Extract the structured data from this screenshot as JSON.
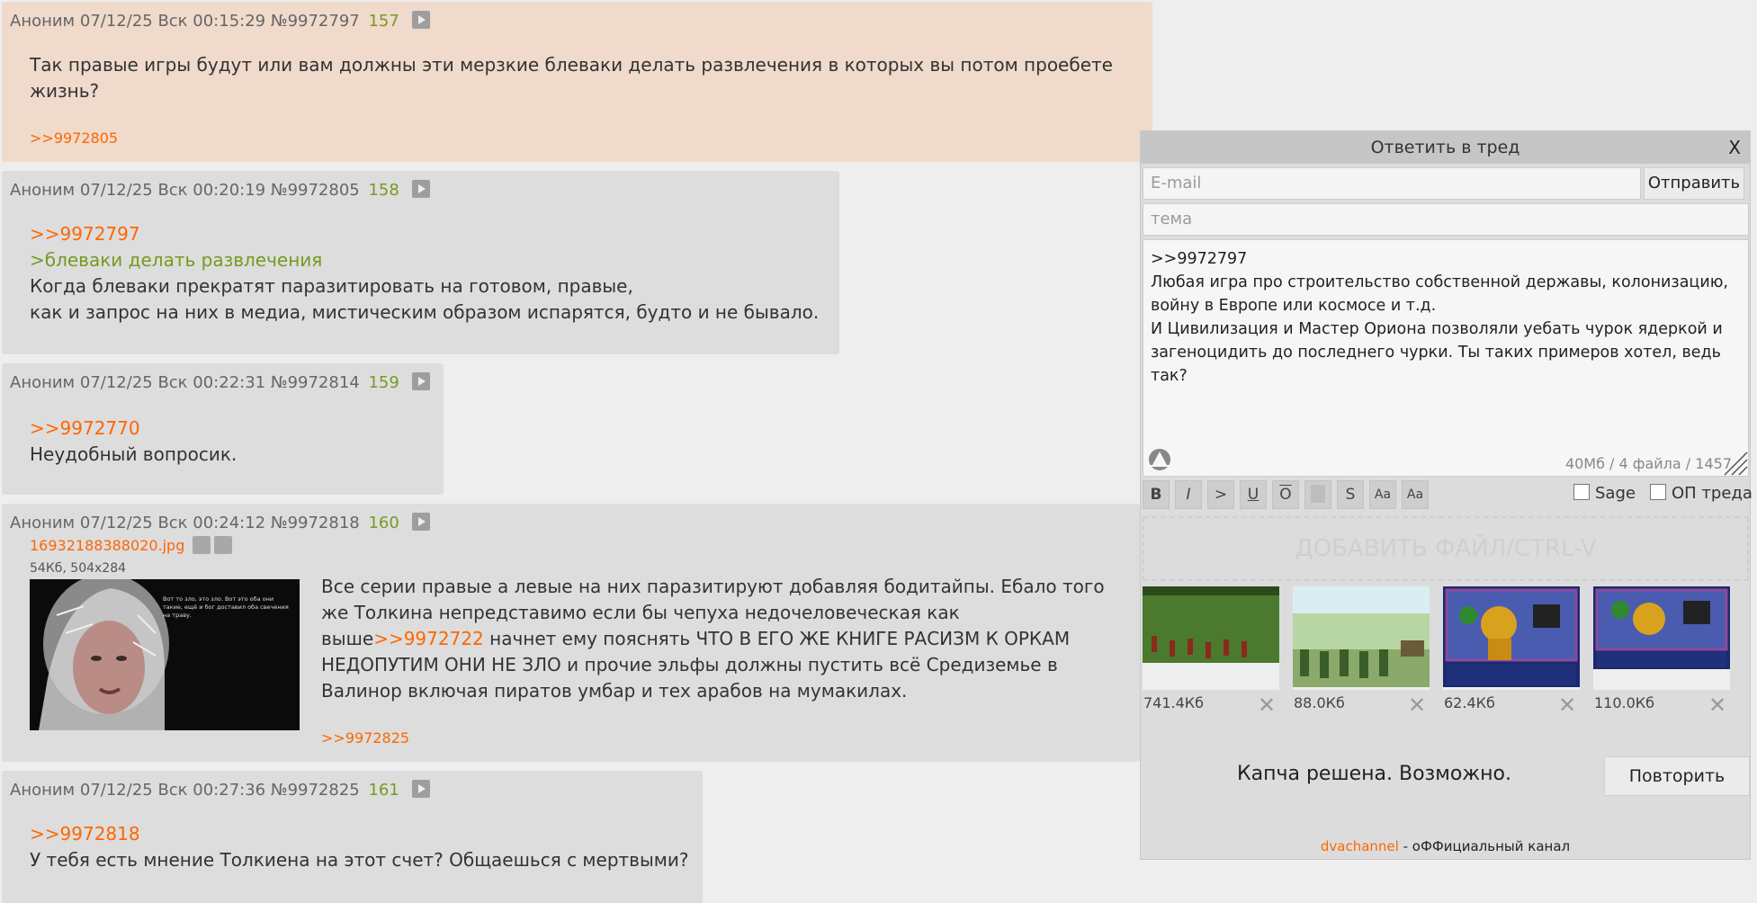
{
  "posts": [
    {
      "author": "Аноним",
      "datetime": "07/12/25 Вск 00:15:29",
      "no": "№9972797",
      "index": "157",
      "text": "Так правые игры будут или вам должны эти мерзкие блеваки делать развлечения в которых вы потом проебете жизнь?",
      "replies": ">>9972805"
    },
    {
      "author": "Аноним",
      "datetime": "07/12/25 Вск 00:20:19",
      "no": "№9972805",
      "index": "158",
      "link": ">>9972797",
      "quote": ">блеваки делать развлечения",
      "line1": "Когда блеваки прекратят паразитировать на готовом, правые,",
      "line2": "как и запрос на них в медиа, мистическим образом испарятся, будто и не бывало."
    },
    {
      "author": "Аноним",
      "datetime": "07/12/25 Вск 00:22:31",
      "no": "№9972814",
      "index": "159",
      "link": ">>9972770",
      "line1": "Неудобный вопросик."
    },
    {
      "author": "Аноним",
      "datetime": "07/12/25 Вск 00:24:12",
      "no": "№9972818",
      "index": "160",
      "file_name": "16932188388020.jpg",
      "file_size": "54Кб, 504x284",
      "text_before": "Все серии правые а левые на них паразитируют добавляя бодитайпы. Ебало того же Толкина непредставимо если бы чепуха недочеловеческая как выше",
      "inline_link": ">>9972722",
      "text_after": " начнет ему пояснять ЧТО В ЕГО ЖЕ КНИГЕ РАСИЗМ К ОРКАМ НЕДОПУТИМ ОНИ НЕ ЗЛО и прочие эльфы должны пустить всё Средиземье в Валинор включая пиратов умбар и тех арабов на мумакилах.",
      "replies": ">>9972825",
      "thumb_caption": "Вот то зло, это зло. Вот это оба они такие, ещё и бог доставил оба свечения на траву."
    },
    {
      "author": "Аноним",
      "datetime": "07/12/25 Вск 00:27:36",
      "no": "№9972825",
      "index": "161",
      "link": ">>9972818",
      "line1": "У тебя есть мнение Толкиена на этот счет? Общаешься с мертвыми?"
    }
  ],
  "form": {
    "title": "Ответить в тред",
    "close": "X",
    "email_placeholder": "E-mail",
    "send": "Отправить",
    "subject_placeholder": "тема",
    "message": ">>9972797\nЛюбая игра про строительство собственной державы, колонизацию, войну в Европе или космосе и т.д.\nИ Цивилизация и Мастер Ориона позволяли уебать чурок ядеркой и загеноцидить до последнего чурки. Ты таких примеров хотел, ведь так?",
    "limits": "40Мб / 4 файла / 1457",
    "markup": [
      "B",
      "I",
      ">",
      "U",
      "O",
      "",
      "S",
      "Aa",
      "Aa"
    ],
    "sage_label": "Sage",
    "op_label": "ОП треда",
    "drop_label": "ДОБАВИТЬ ФАЙЛ/CTRL-V",
    "attachments": [
      {
        "size": "741.4Кб",
        "remove": "✕"
      },
      {
        "size": "88.0Кб",
        "remove": "✕"
      },
      {
        "size": "62.4Кб",
        "remove": "✕"
      },
      {
        "size": "110.0Кб",
        "remove": "✕"
      }
    ],
    "captcha_text": "Капча решена. Возможно.",
    "retry": "Повторить",
    "footer_channel": "dvachannel",
    "footer_text": " - оФФициальный канал"
  },
  "colors": {
    "link": "#ff6600",
    "greentext": "#789922",
    "op_bg": "#efdacb",
    "post_bg": "#dddddd"
  }
}
